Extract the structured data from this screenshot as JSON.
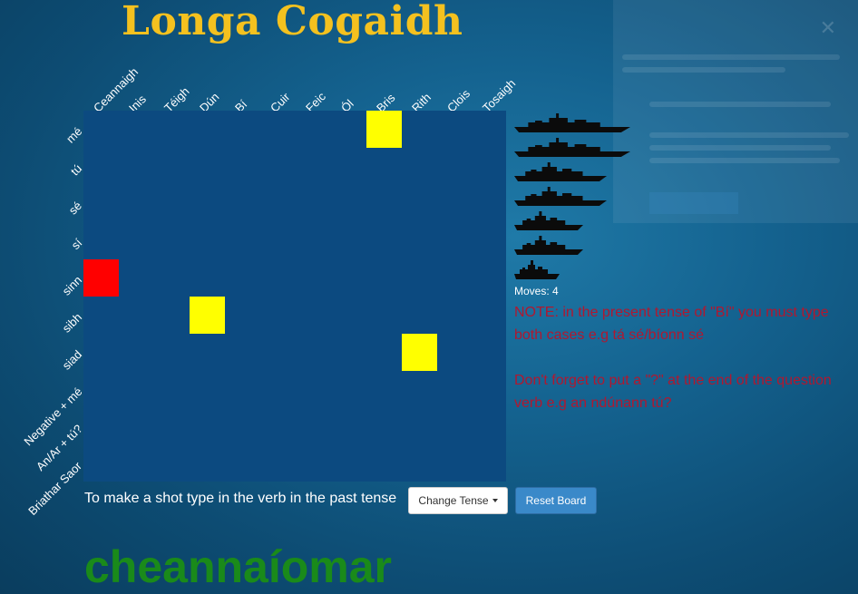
{
  "title": "Longa Cogaidh",
  "columns": [
    "Ceannaigh",
    "Inis",
    "Téigh",
    "Dún",
    "Bí",
    "Cuir",
    "Feic",
    "Ól",
    "Bris",
    "Rith",
    "Clois",
    "Tosaigh"
  ],
  "rows": [
    "mé",
    "tú",
    "sé",
    "sí",
    "sinn",
    "sibh",
    "siad",
    "Negative + mé",
    "An/Ar + tú?",
    "Briathar Saor"
  ],
  "board": {
    "hits": [
      {
        "row": 4,
        "col": 0
      }
    ],
    "misses": [
      {
        "row": 0,
        "col": 8
      },
      {
        "row": 5,
        "col": 3
      },
      {
        "row": 6,
        "col": 9
      }
    ],
    "hit_color": "#ff0000",
    "miss_color": "#ffff00",
    "board_color": "#0c4a80"
  },
  "ships": {
    "icon": "battleship-silhouette-icon",
    "count": 7
  },
  "moves": "Moves: 4",
  "note1": "NOTE: in the present tense of \"Bí\" you must type both cases e.g tá sé/bíonn sé",
  "note2": "Don't forget to put a \"?\" at the end of the question verb e.g an ndúnann tú?",
  "instruction": "To make a shot type in the verb in the past tense",
  "answer": "cheannaíomar",
  "buttons": {
    "change_tense": "Change Tense",
    "reset_board": "Reset Board"
  },
  "colors": {
    "title": "#f4c11f",
    "note": "#b01830",
    "answer": "#1a8a1a"
  }
}
